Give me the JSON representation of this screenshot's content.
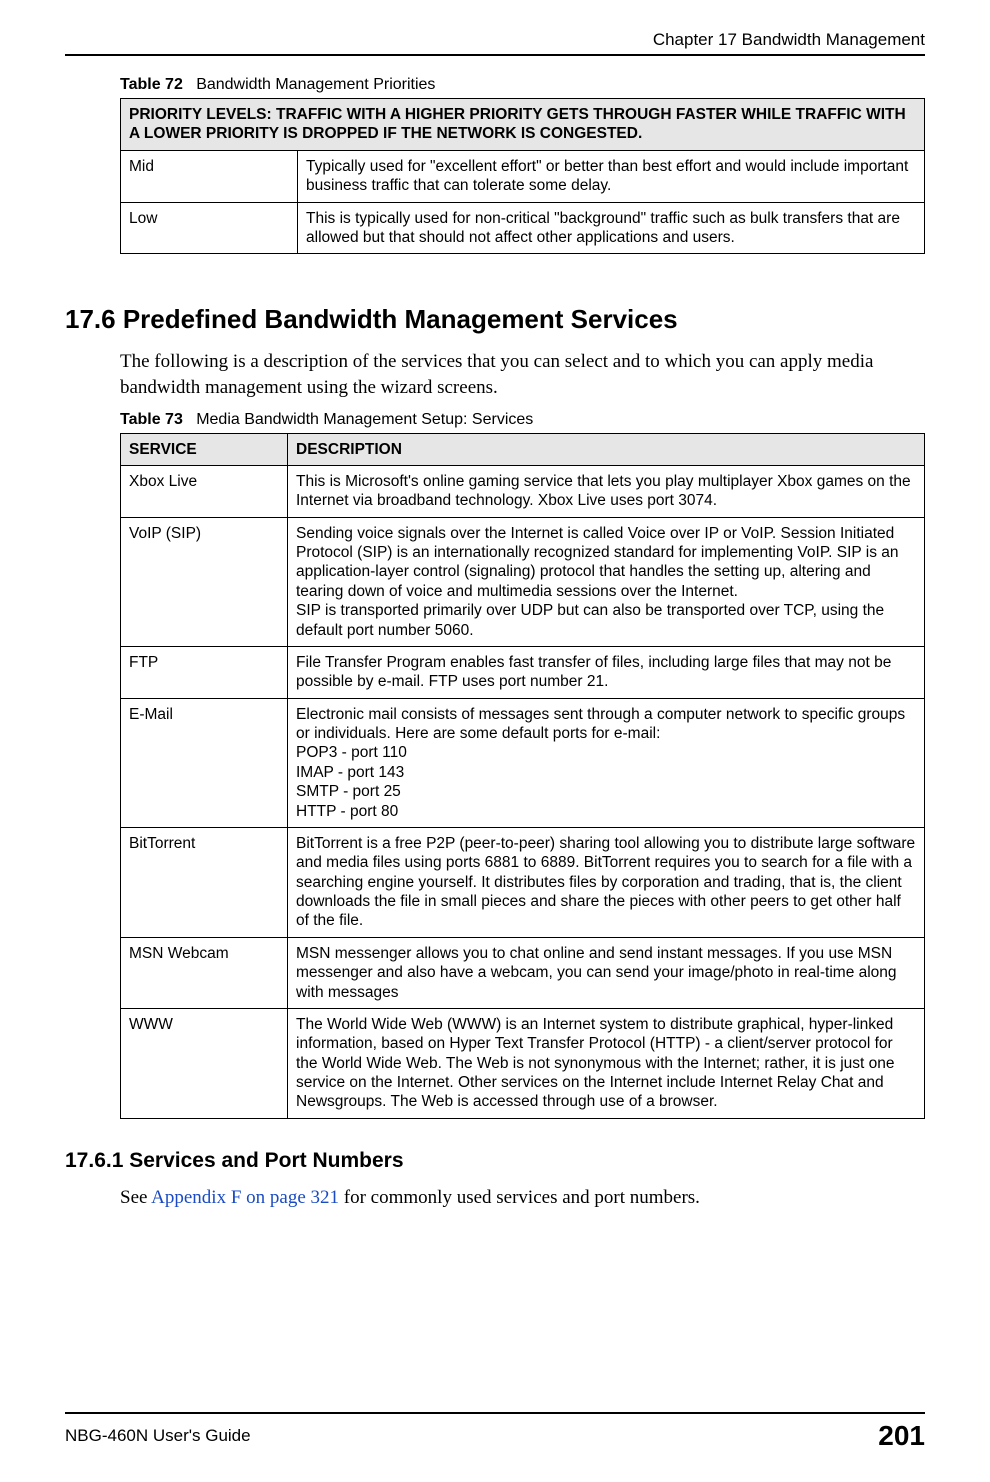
{
  "header": {
    "chapter": "Chapter 17 Bandwidth Management"
  },
  "footer": {
    "guide": "NBG-460N User's Guide",
    "page": "201"
  },
  "table72": {
    "caption_bold": "Table 72",
    "caption_rest": "Bandwidth Management Priorities",
    "header": "PRIORITY LEVELS: TRAFFIC WITH A HIGHER PRIORITY GETS THROUGH FASTER WHILE TRAFFIC WITH A LOWER PRIORITY IS DROPPED IF THE NETWORK IS CONGESTED.",
    "rows": [
      {
        "level": "Mid",
        "desc": "Typically used for \"excellent effort\" or better than best effort and would include important business traffic that can tolerate some delay."
      },
      {
        "level": "Low",
        "desc": "This is typically used for non-critical \"background\" traffic such as bulk transfers that are allowed but that should not affect other applications and users."
      }
    ]
  },
  "section176": {
    "heading": "17.6  Predefined Bandwidth Management Services",
    "para": "The following is a description of the services that you can select and to which you can apply media bandwidth management using the wizard screens."
  },
  "table73": {
    "caption_bold": "Table 73",
    "caption_rest": "Media Bandwidth Management Setup: Services",
    "col1": "SERVICE",
    "col2": "DESCRIPTION",
    "rows": [
      {
        "service": "Xbox Live",
        "desc": "This is Microsoft's online gaming service that lets you play multiplayer Xbox games on the Internet via broadband technology. Xbox Live uses port 3074."
      },
      {
        "service": "VoIP (SIP)",
        "desc": "Sending voice signals over the Internet is called Voice over IP or VoIP. Session Initiated Protocol  (SIP) is an internationally recognized standard for implementing VoIP. SIP is an application-layer control (signaling) protocol that handles the setting up, altering and tearing down of voice and multimedia sessions over the Internet.\nSIP is transported primarily over UDP but can also be transported over TCP, using the default port number 5060."
      },
      {
        "service": "FTP",
        "desc": "File Transfer Program enables fast transfer of files, including large files that may not be possible by e-mail. FTP uses port number 21."
      },
      {
        "service": "E-Mail",
        "desc": "Electronic mail consists of messages sent through a computer network to specific groups or individuals. Here are some default ports for e-mail:\nPOP3 - port 110\nIMAP - port 143\nSMTP - port 25\nHTTP - port 80"
      },
      {
        "service": "BitTorrent",
        "desc": "BitTorrent is a free P2P (peer-to-peer) sharing tool allowing you to distribute large software and media files using ports 6881 to 6889. BitTorrent requires you to search for a file with a searching engine yourself. It distributes files by corporation and trading, that is, the client downloads the file in small pieces and share the pieces with other peers to get other half of the file."
      },
      {
        "service": "MSN Webcam",
        "desc": "MSN messenger allows you to chat online and send instant messages. If you use MSN messenger and also have a webcam, you can send your image/photo in real-time along with messages"
      },
      {
        "service": "WWW",
        "desc": "The World Wide Web (WWW) is an Internet system to distribute graphical, hyper-linked information, based on Hyper Text Transfer Protocol (HTTP) - a client/server protocol for the World Wide Web. The Web is not synonymous with the Internet; rather, it is just one service on the Internet. Other services on the Internet include Internet Relay Chat and Newsgroups. The Web is accessed through use of a browser."
      }
    ]
  },
  "section1761": {
    "heading": "17.6.1  Services and Port Numbers",
    "para_pre": "See ",
    "link": "Appendix F on page 321",
    "para_post": " for commonly used services and port numbers."
  }
}
